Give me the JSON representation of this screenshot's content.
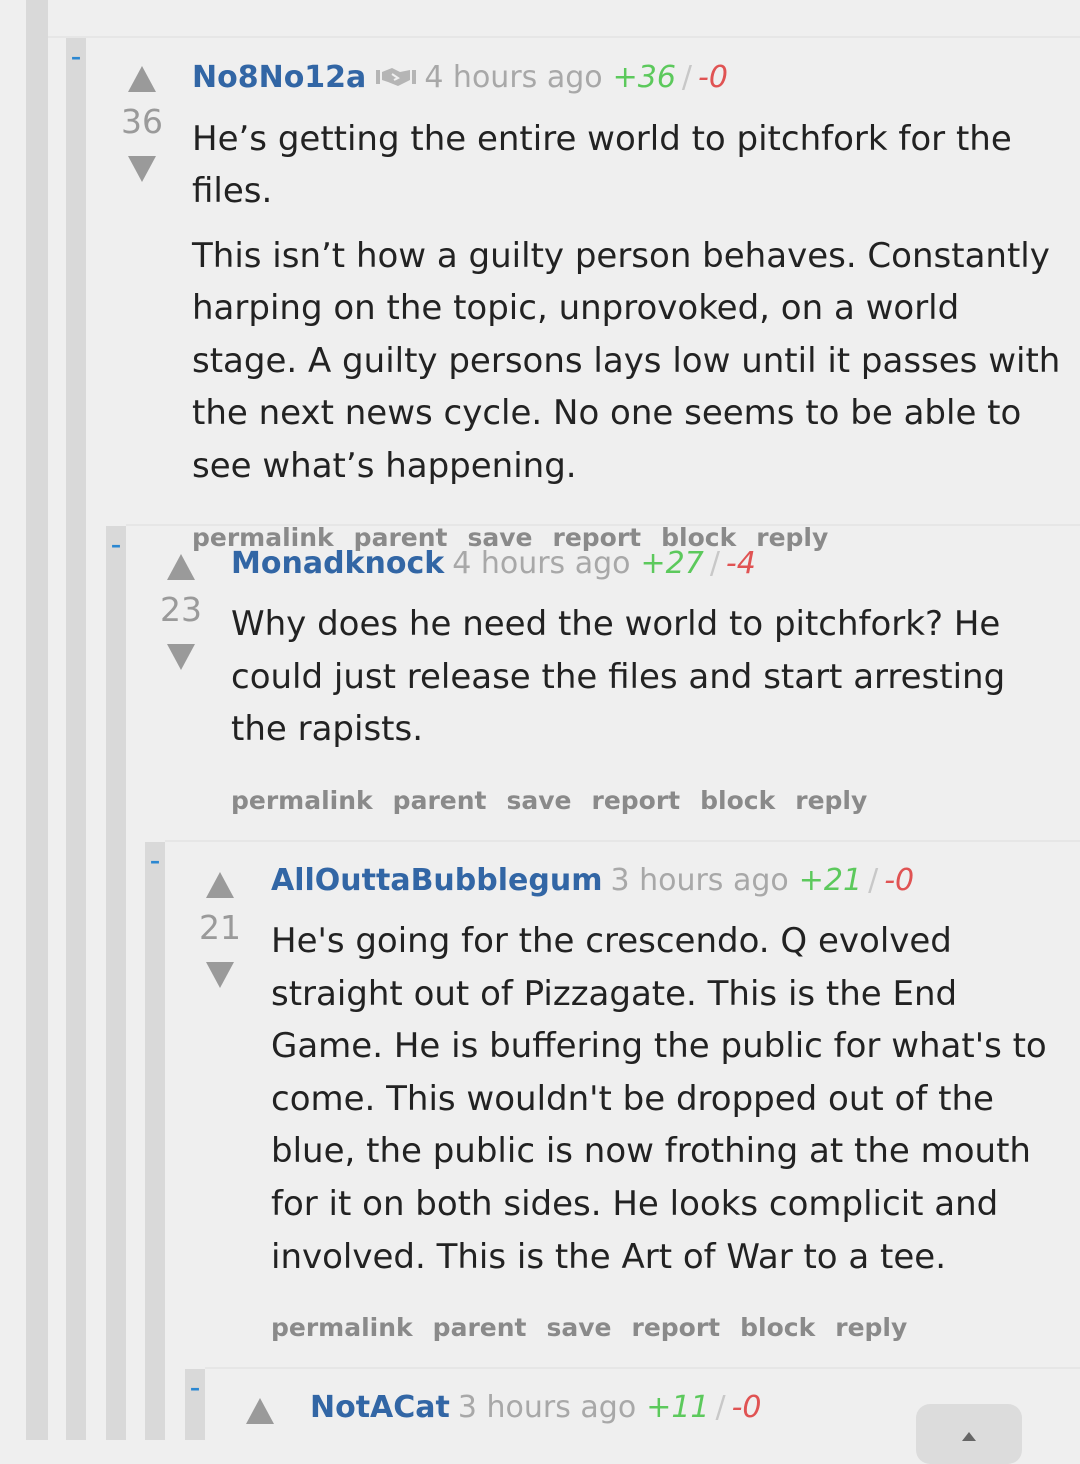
{
  "colors": {
    "accent_author": "#3266a5",
    "upvote": "#5cc95c",
    "downvote": "#e05353",
    "collapse": "#2b87d1",
    "background": "#efefef",
    "thread_bar": "#d9d9d9"
  },
  "icons": {
    "collapse": "minus-icon",
    "vote_up": "upvote-arrow-icon",
    "vote_down": "downvote-arrow-icon",
    "flair": "handshake-icon",
    "scroll_top": "chevron-up-icon"
  },
  "comments": [
    {
      "author": "No8No12a",
      "time": "4 hours ago",
      "up": "+36",
      "down": "-0",
      "score": "36",
      "has_flair": true,
      "paragraphs": [
        "He’s getting the entire world to pitchfork for the files.",
        "This isn’t how a guilty person behaves. Constantly harping on the topic, unprovoked, on a world stage. A guilty persons lays low until it passes with the next news cycle. No one seems to be able to see what’s happening."
      ]
    },
    {
      "author": "Monadknock",
      "time": "4 hours ago",
      "up": "+27",
      "down": "-4",
      "score": "23",
      "paragraphs": [
        "Why does he need the world to pitchfork? He could just release the files and start arresting the rapists."
      ]
    },
    {
      "author": "AllOuttaBubblegum",
      "time": "3 hours ago",
      "up": "+21",
      "down": "-0",
      "score": "21",
      "paragraphs": [
        "He's going for the crescendo. Q evolved straight out of Pizzagate. This is the End Game. He is buffering the public for what's to come. This wouldn't be dropped out of the blue, the public is now frothing at the mouth for it on both sides. He looks complicit and involved. This is the Art of War to a tee."
      ]
    },
    {
      "author": "NotACat",
      "time": "3 hours ago",
      "up": "+11",
      "down": "-0"
    }
  ],
  "actions": {
    "permalink": "permalink",
    "parent": "parent",
    "save": "save",
    "report": "report",
    "block": "block",
    "reply": "reply"
  },
  "collapse_label": "–",
  "slash": "/"
}
